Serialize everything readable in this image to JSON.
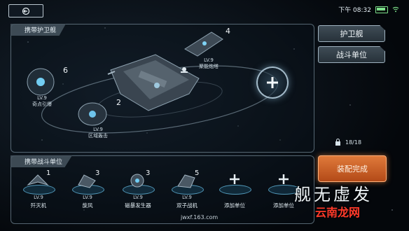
{
  "status_bar": {
    "time": "下午 08:32"
  },
  "fleet_panel": {
    "title": "携带护卫舰",
    "ships": [
      {
        "level": "LV.9",
        "name": "聚能炮塔",
        "count": "4"
      },
      {
        "level": "LV.9",
        "name": "奇点引爆",
        "count": "6"
      },
      {
        "level": "LV.9",
        "name": "区域轰击",
        "count": "2"
      }
    ]
  },
  "side_menu": {
    "escort_label": "护卫舰",
    "combat_label": "战斗单位",
    "capacity": "18/18",
    "confirm_label": "装配完成"
  },
  "units_panel": {
    "title": "携带战斗单位",
    "units": [
      {
        "level": "LV.9",
        "name": "歼灭机",
        "count": "1"
      },
      {
        "level": "LV.9",
        "name": "旋风",
        "count": "3"
      },
      {
        "level": "LV.9",
        "name": "磁暴发生器",
        "count": "3"
      },
      {
        "level": "LV.9",
        "name": "双子战机",
        "count": "5"
      },
      {
        "level": "",
        "name": "添加单位",
        "count": ""
      },
      {
        "level": "",
        "name": "添加单位",
        "count": ""
      }
    ]
  },
  "watermark": {
    "game_title": "舰无虚发",
    "site": "云南龙网",
    "url": "jwxf.163.com"
  },
  "colors": {
    "confirm": "#d0642a",
    "panel_border": "#96afbe",
    "platform_glow": "#6ec8f0"
  }
}
